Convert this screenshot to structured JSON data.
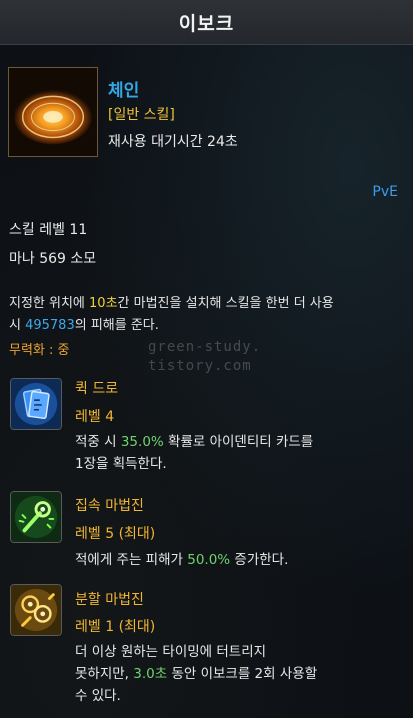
{
  "header": {
    "title": "이보크"
  },
  "skill": {
    "icon": "magic-circle-icon",
    "name": "체인",
    "type": "[일반 스킬]",
    "cooldown": "재사용 대기시간 24초",
    "mode": "PvE",
    "level": "스킬 레벨 11",
    "mana": "마나 569 소모"
  },
  "description": {
    "part1": "지정한 위치에 ",
    "duration": "10초",
    "part2": "간 마법진을 설치해 스킬을 한번 더 사용",
    "part3": "시 ",
    "damage": "495783",
    "part4": "의 피해를 준다."
  },
  "stagger": "무력화 : 중",
  "watermark": {
    "line1": "green-study.",
    "line2": "tistory.com"
  },
  "tripods": [
    {
      "icon": "card-icon",
      "name": "퀵 드로",
      "level": "레벨 4",
      "desc_a": "적중 시 ",
      "desc_value": "35.0%",
      "desc_b": " 확률로 아이덴티티 카드를",
      "desc_c": "1장을 획득한다."
    },
    {
      "icon": "focus-magic-icon",
      "name": "집속 마법진",
      "level": "레벨 5 (최대)",
      "desc_a": "적에게 주는 피해가 ",
      "desc_value": "50.0%",
      "desc_b": " 증가한다."
    },
    {
      "icon": "split-magic-icon",
      "name": "분할 마법진",
      "level": "레벨 1 (최대)",
      "desc_a": "더 이상 원하는 타이밍에 터트리지",
      "desc_b": "못하지만, ",
      "desc_value": "3.0초",
      "desc_c": " 동안 이보크를 2회 사용할",
      "desc_d": "수 있다."
    }
  ],
  "colors": {
    "skill_name": "#35a6e6",
    "skill_type": "#f0c33a",
    "tripod_text": "#f0b532",
    "value_green": "#6fd26f",
    "value_blue": "#3da9ea",
    "value_yellow": "#f0d23a",
    "stagger": "#f0a52e"
  }
}
